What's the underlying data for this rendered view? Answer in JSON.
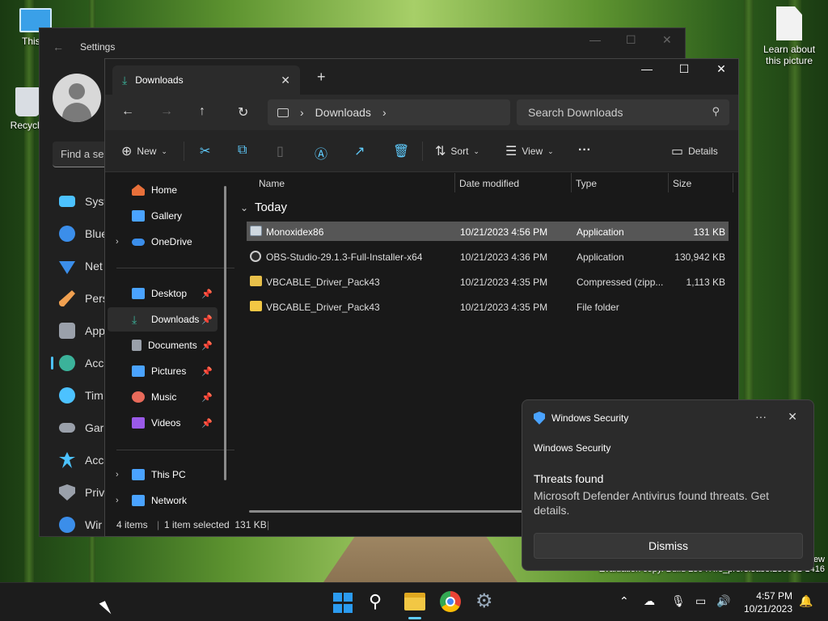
{
  "desktop": {
    "icons": [
      {
        "label": "This P",
        "icon": "monitor-icon"
      },
      {
        "label": "Recycle",
        "icon": "recycle-bin-icon"
      },
      {
        "label": "Learn about this picture",
        "icon": "document-icon"
      }
    ],
    "watermark_line1": "ew",
    "watermark_line2": "Evaluation copy. Build 25947.rs_prerelease.230901-1416"
  },
  "settings": {
    "title": "Settings",
    "find_placeholder": "Find a se",
    "nav": [
      {
        "label": "Syst",
        "icon": "system-icon",
        "color": "#4cc2ff"
      },
      {
        "label": "Blue",
        "icon": "bluetooth-icon",
        "color": "#3b8eea"
      },
      {
        "label": "Net",
        "icon": "wifi-icon",
        "color": "#3b8eea"
      },
      {
        "label": "Pers",
        "icon": "brush-icon",
        "color": "#f0a050"
      },
      {
        "label": "App",
        "icon": "apps-icon",
        "color": "#9aa0aa"
      },
      {
        "label": "Acc",
        "icon": "account-icon",
        "color": "#3bb29a",
        "active": true
      },
      {
        "label": "Tim",
        "icon": "clock-icon",
        "color": "#4cc2ff"
      },
      {
        "label": "Gar",
        "icon": "gamepad-icon",
        "color": "#9aa0aa"
      },
      {
        "label": "Acc",
        "icon": "accessibility-icon",
        "color": "#4cc2ff"
      },
      {
        "label": "Priv",
        "icon": "shield-icon",
        "color": "#9aa0aa"
      },
      {
        "label": "Wir",
        "icon": "update-icon",
        "color": "#3b8eea"
      }
    ]
  },
  "explorer": {
    "tab_title": "Downloads",
    "breadcrumb": "Downloads",
    "search_placeholder": "Search Downloads",
    "toolbar": {
      "new_label": "New",
      "sort_label": "Sort",
      "view_label": "View",
      "details_label": "Details"
    },
    "nav": [
      {
        "label": "Home",
        "icon": "home-icon",
        "color": "#e8703a"
      },
      {
        "label": "Gallery",
        "icon": "gallery-icon",
        "color": "#4aa3ff"
      },
      {
        "label": "OneDrive",
        "icon": "onedrive-icon",
        "color": "#3b8eea",
        "expand": true
      },
      {
        "label": "Desktop",
        "icon": "desktop-icon",
        "color": "#4aa3ff",
        "pinned": true
      },
      {
        "label": "Downloads",
        "icon": "download-icon",
        "color": "#3bb29a",
        "pinned": true,
        "selected": true
      },
      {
        "label": "Documents",
        "icon": "documents-icon",
        "color": "#9aa0aa",
        "pinned": true
      },
      {
        "label": "Pictures",
        "icon": "pictures-icon",
        "color": "#4aa3ff",
        "pinned": true
      },
      {
        "label": "Music",
        "icon": "music-icon",
        "color": "#e86a5a",
        "pinned": true
      },
      {
        "label": "Videos",
        "icon": "videos-icon",
        "color": "#9a5ae8",
        "pinned": true
      },
      {
        "label": "This PC",
        "icon": "pc-icon",
        "color": "#4aa3ff",
        "expand": true
      },
      {
        "label": "Network",
        "icon": "network-icon",
        "color": "#4aa3ff",
        "expand": true
      }
    ],
    "columns": {
      "name": "Name",
      "date": "Date modified",
      "type": "Type",
      "size": "Size"
    },
    "group": "Today",
    "files": [
      {
        "name": "Monoxidex86",
        "date": "10/21/2023 4:56 PM",
        "type": "Application",
        "size": "131 KB",
        "icon": "application-icon",
        "selected": true
      },
      {
        "name": "OBS-Studio-29.1.3-Full-Installer-x64",
        "date": "10/21/2023 4:36 PM",
        "type": "Application",
        "size": "130,942 KB",
        "icon": "obs-icon"
      },
      {
        "name": "VBCABLE_Driver_Pack43",
        "date": "10/21/2023 4:35 PM",
        "type": "Compressed (zipp...",
        "size": "1,113 KB",
        "icon": "zip-folder-icon"
      },
      {
        "name": "VBCABLE_Driver_Pack43",
        "date": "10/21/2023 4:35 PM",
        "type": "File folder",
        "size": "",
        "icon": "folder-icon"
      }
    ],
    "status": {
      "count": "4 items",
      "selection": "1 item selected  131 KB"
    }
  },
  "toast": {
    "source": "Windows Security",
    "app_name": "Windows Security",
    "title": "Threats found",
    "message": "Microsoft Defender Antivirus found threats. Get details.",
    "dismiss_label": "Dismiss"
  },
  "taskbar": {
    "time": "4:57 PM",
    "date": "10/21/2023"
  }
}
